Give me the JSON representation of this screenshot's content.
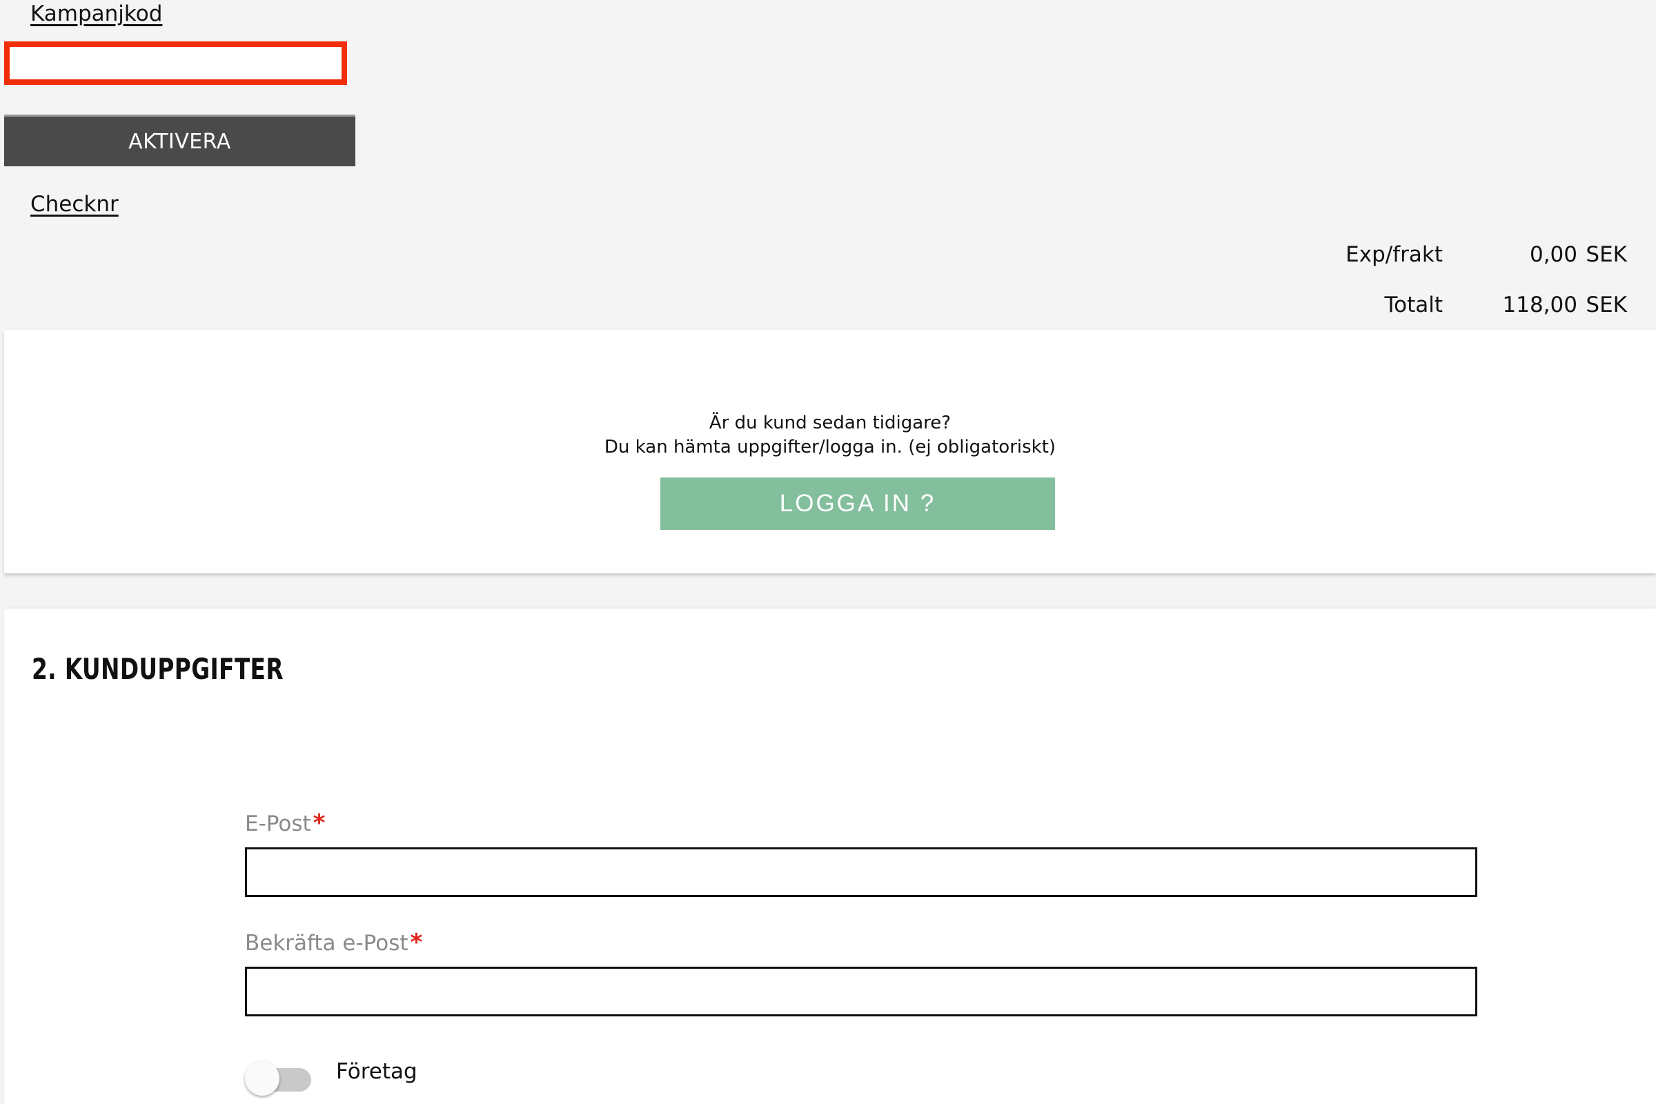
{
  "promo": {
    "link_label": "Kampanjkod",
    "input_value": "",
    "button_label": "AKTIVERA",
    "check_label": "Checknr",
    "highlight_color": "#f22d0a"
  },
  "totals": {
    "shipping_label": "Exp/frakt",
    "shipping_value": "0,00",
    "total_label": "Totalt",
    "total_value": "118,00",
    "currency": "SEK"
  },
  "login": {
    "line1": "Är du kund sedan tidigare?",
    "line2": "Du kan hämta uppgifter/logga in. (ej obligatoriskt)",
    "button_label": "LOGGA IN ?",
    "button_color": "#84bf9d"
  },
  "customer": {
    "title": "2. KUNDUPPGIFTER",
    "email_label": "E-Post",
    "email_value": "",
    "confirm_email_label": "Bekräfta e-Post",
    "confirm_email_value": "",
    "required_marker": "*",
    "company_toggle_label": "Företag",
    "company_toggle_on": false
  }
}
